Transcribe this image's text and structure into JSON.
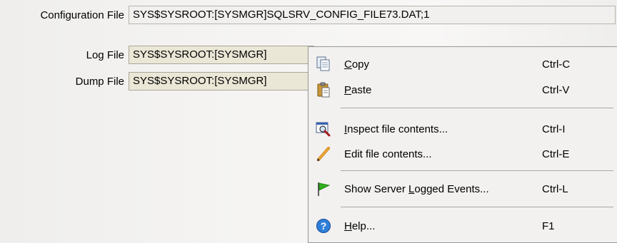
{
  "fields": [
    {
      "label": "Configuration File",
      "value": "SYS$SYSROOT:[SYSMGR]SQLSRV_CONFIG_FILE73.DAT;1"
    },
    {
      "label": "Log File",
      "value": "SYS$SYSROOT:[SYSMGR]"
    },
    {
      "label": "Dump File",
      "value": "SYS$SYSROOT:[SYSMGR]"
    }
  ],
  "context_menu": {
    "items": [
      {
        "icon": "copy-icon",
        "label_pre": "",
        "label_key": "C",
        "label_post": "opy",
        "shortcut": "Ctrl-C"
      },
      {
        "icon": "paste-icon",
        "label_pre": "",
        "label_key": "P",
        "label_post": "aste",
        "shortcut": "Ctrl-V"
      },
      {
        "icon": "inspect-icon",
        "label_pre": "",
        "label_key": "I",
        "label_post": "nspect file contents...",
        "shortcut": "Ctrl-I"
      },
      {
        "icon": "pencil-icon",
        "label_pre": "Edit file contents...",
        "label_key": "",
        "label_post": "",
        "shortcut": "Ctrl-E"
      },
      {
        "icon": "flag-icon",
        "label_pre": "Show Server ",
        "label_key": "L",
        "label_post": "ogged Events...",
        "shortcut": "Ctrl-L"
      },
      {
        "icon": "help-icon",
        "label_pre": "",
        "label_key": "H",
        "label_post": "elp...",
        "shortcut": "F1"
      }
    ]
  },
  "colors": {
    "field_bg": "#ebe7d6",
    "menu_bg": "#f2f1f0",
    "flag_green": "#2fae1f",
    "help_blue": "#2f7fd8"
  }
}
